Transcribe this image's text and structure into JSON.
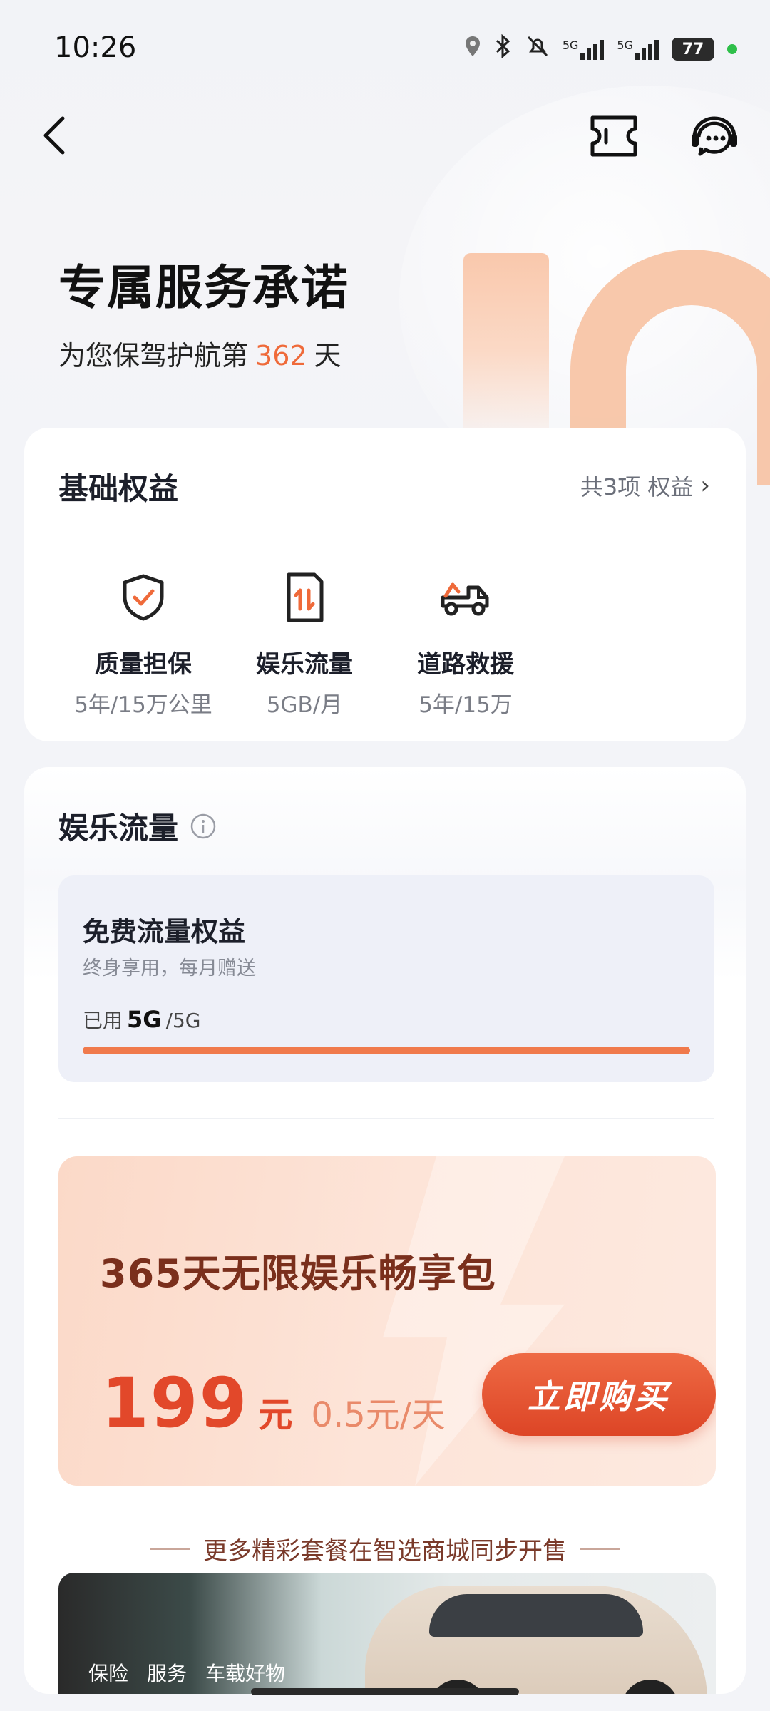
{
  "status": {
    "time": "10:26",
    "battery": "77",
    "network_a": "5G",
    "network_b": "5G"
  },
  "nav": {
    "back_icon": "chevron-left-icon",
    "ticket_icon": "ticket-icon",
    "service_icon": "customer-service-icon"
  },
  "hero": {
    "title": "专属服务承诺",
    "subtitle_prefix": "为您保驾护航第",
    "days": "362",
    "subtitle_suffix": "天"
  },
  "basic": {
    "title": "基础权益",
    "more": "共3项 权益",
    "items": [
      {
        "name": "质量担保",
        "desc": "5年/15万公里",
        "icon": "shield-check-icon"
      },
      {
        "name": "娱乐流量",
        "desc": "5GB/月",
        "icon": "sim-data-icon"
      },
      {
        "name": "道路救援",
        "desc": "5年/15万",
        "icon": "tow-truck-icon"
      }
    ]
  },
  "traffic": {
    "title": "娱乐流量",
    "free_title": "免费流量权益",
    "free_sub": "终身享用，每月赠送",
    "used_label": "已用",
    "used_value": "5G",
    "used_total": "/5G",
    "used_fraction": 1.0,
    "promo_title": "365天无限娱乐畅享包",
    "price": "199",
    "price_unit": "元",
    "per_day": "0.5元/天",
    "buy_label": "立即购买",
    "more_text": "更多精彩套餐在智选商城同步开售",
    "banner_tabs": [
      "保险",
      "服务",
      "车载好物"
    ]
  },
  "colors": {
    "accent": "#ef6a3a",
    "progress": "#f07a4c",
    "buy_button": "#dd4526"
  }
}
